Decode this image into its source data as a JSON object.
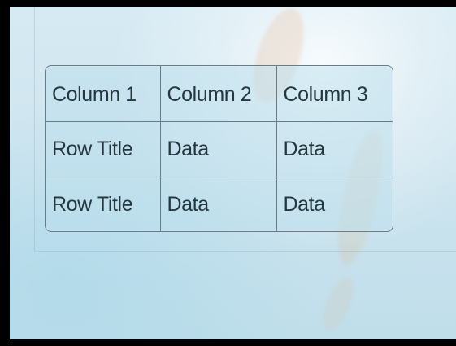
{
  "slide": {
    "table": {
      "headers": [
        "Column 1",
        "Column 2",
        "Column 3"
      ],
      "rows": [
        [
          "Row Title",
          "Data",
          "Data"
        ],
        [
          "Row Title",
          "Data",
          "Data"
        ]
      ]
    }
  },
  "colors": {
    "background_frame": "#000000",
    "slide_tint": "#d6eaf3",
    "table_border": "#6b7b83",
    "text": "#24363e"
  }
}
